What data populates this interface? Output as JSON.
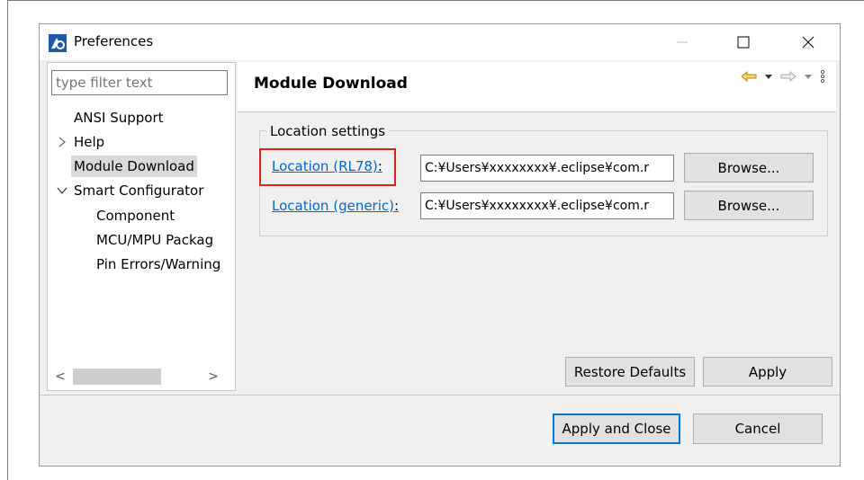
{
  "window": {
    "title": "Preferences"
  },
  "sidebar": {
    "filter_placeholder": "type filter text",
    "items": [
      {
        "label": "ANSI Support"
      },
      {
        "label": "Help"
      },
      {
        "label": "Module Download"
      },
      {
        "label": "Smart Configurator"
      },
      {
        "label": "Component"
      },
      {
        "label": "MCU/MPU Packag"
      },
      {
        "label": "Pin Errors/Warning"
      }
    ],
    "scroll_left": "<",
    "scroll_right": ">"
  },
  "main": {
    "title": "Module Download",
    "group_label": "Location settings",
    "rows": [
      {
        "link": "Location (RL78)",
        "colon": ":",
        "path": "C:¥Users¥xxxxxxxx¥.eclipse¥com.r",
        "browse": "Browse..."
      },
      {
        "link": "Location (generic)",
        "colon": ":",
        "path": "C:¥Users¥xxxxxxxx¥.eclipse¥com.r",
        "browse": "Browse..."
      }
    ],
    "restore_defaults": "Restore Defaults",
    "apply": "Apply"
  },
  "footer": {
    "apply_close": "Apply and Close",
    "cancel": "Cancel"
  },
  "colors": {
    "link": "#0066cc",
    "highlight": "#e0201c",
    "focus": "#0078d7"
  }
}
